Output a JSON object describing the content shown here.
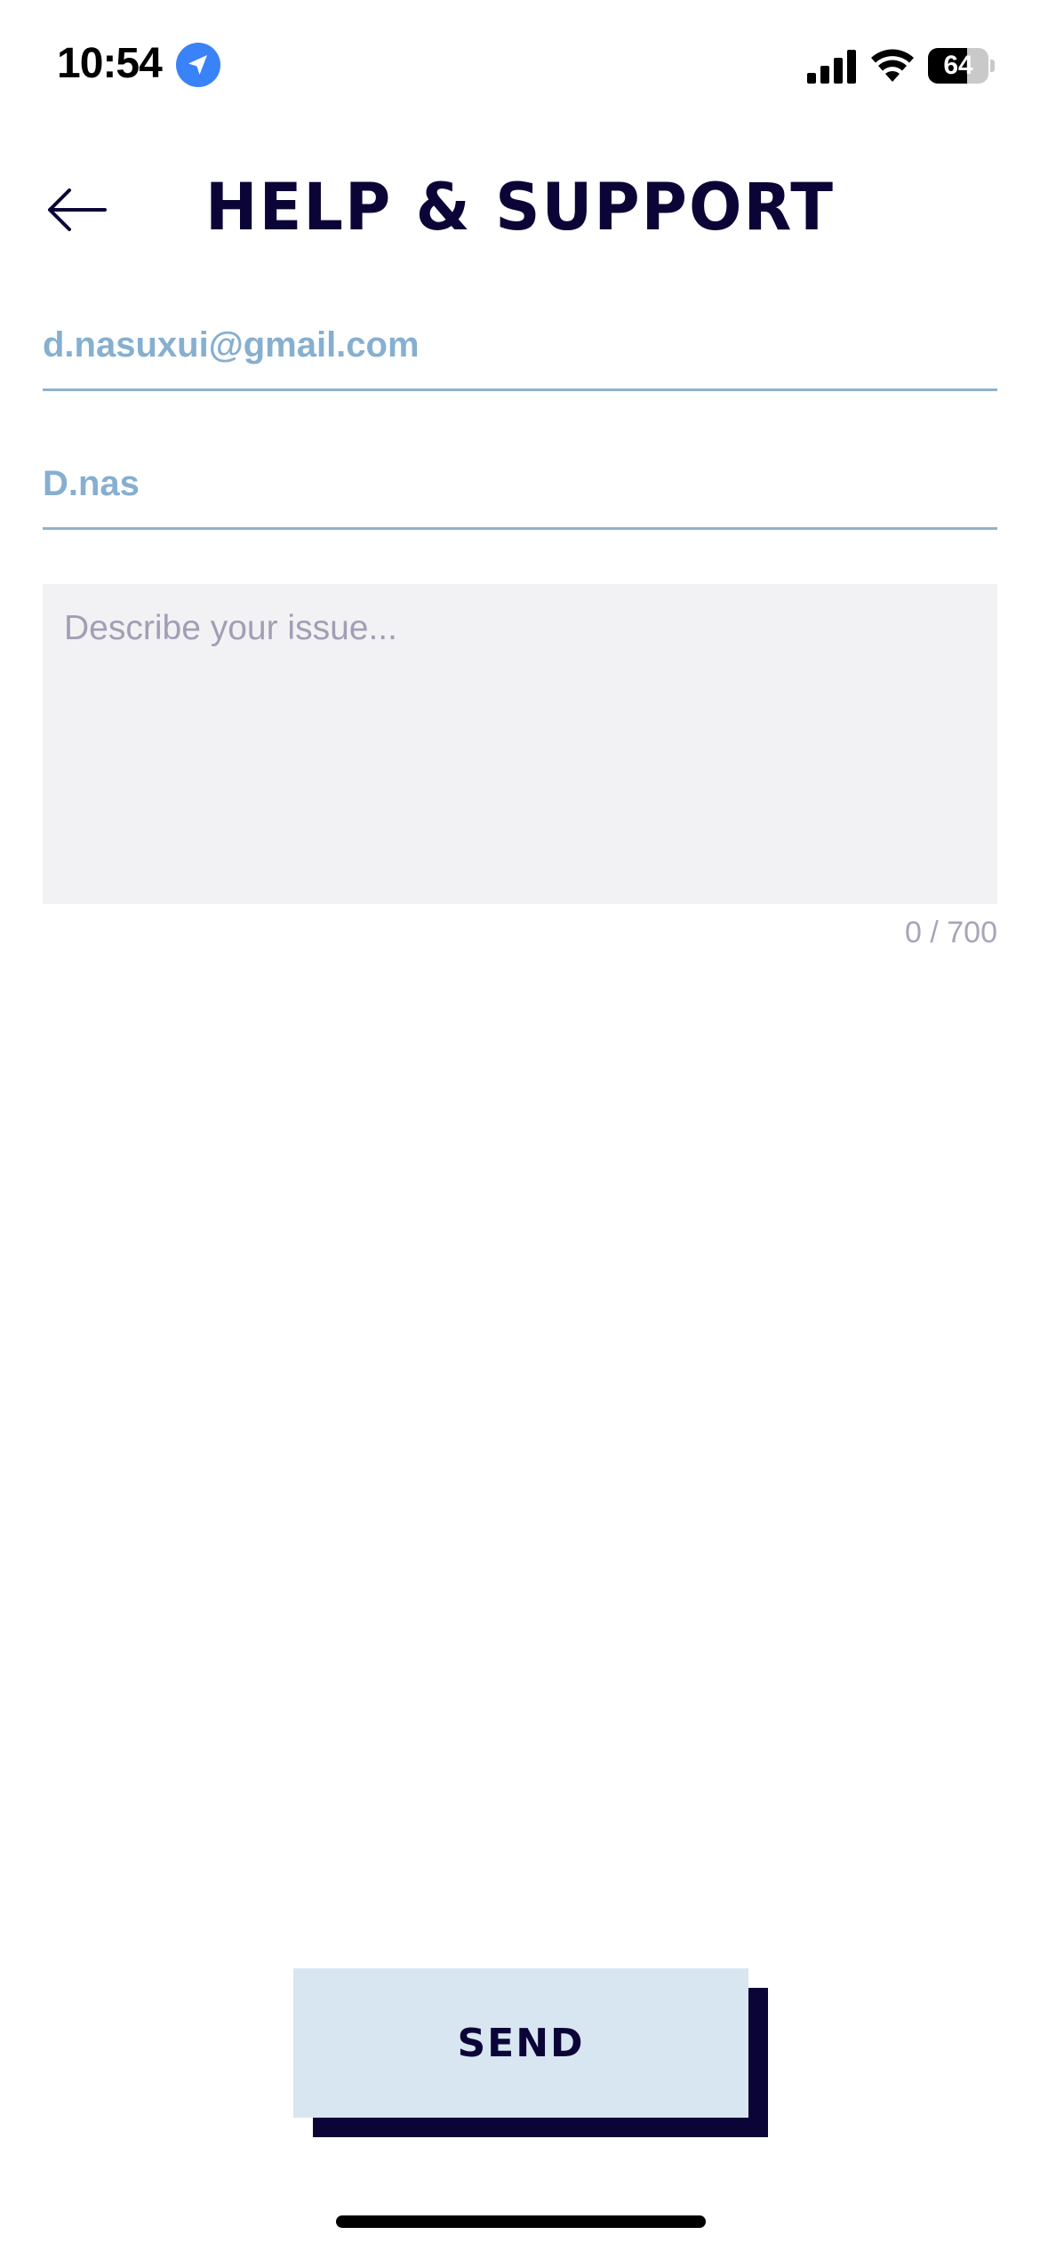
{
  "status_bar": {
    "time": "10:54",
    "battery_level": "64",
    "battery_fraction": 0.64,
    "icons": [
      "location-arrow-icon",
      "cellular-signal-icon",
      "wifi-icon",
      "battery-icon"
    ]
  },
  "header": {
    "title": "HELP & SUPPORT",
    "back_icon": "arrow-left-icon"
  },
  "form": {
    "email_value": "d.nasuxui@gmail.com",
    "name_value": "D.nas",
    "issue_placeholder": "Describe your issue...",
    "char_counter": "0 / 700"
  },
  "actions": {
    "send_label": "SEND"
  },
  "colors": {
    "title": "#0b0537",
    "field_text": "#86afd0",
    "field_underline": "#8fb3cf",
    "textarea_bg": "#f2f2f4",
    "send_button_bg": "#d8e6f1",
    "send_shadow": "#0b0537",
    "location_badge": "#3a82f7"
  }
}
